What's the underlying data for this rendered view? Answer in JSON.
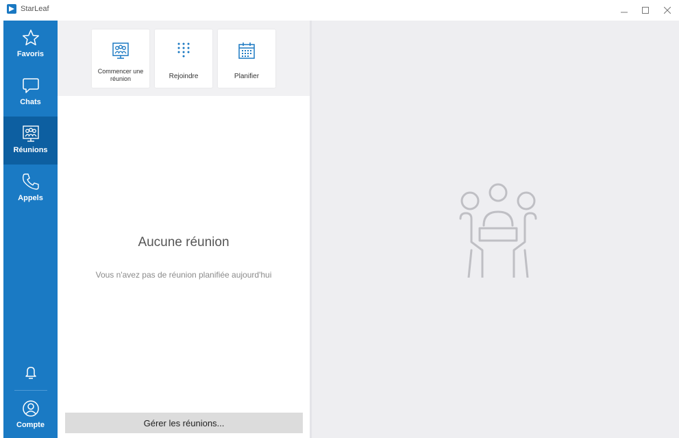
{
  "window": {
    "title": "StarLeaf"
  },
  "sidebar": {
    "items": [
      {
        "label": "Favoris",
        "icon": "star-icon"
      },
      {
        "label": "Chats",
        "icon": "chat-bubble-icon"
      },
      {
        "label": "Réunions",
        "icon": "meeting-icon",
        "active": true
      },
      {
        "label": "Appels",
        "icon": "phone-icon"
      }
    ],
    "bottom": {
      "notifications_icon": "bell-icon",
      "account_label": "Compte",
      "account_icon": "account-icon"
    }
  },
  "actions": [
    {
      "label": "Commencer une réunion",
      "icon": "meeting-icon"
    },
    {
      "label": "Rejoindre",
      "icon": "keypad-icon"
    },
    {
      "label": "Planifier",
      "icon": "calendar-icon"
    }
  ],
  "empty_state": {
    "title": "Aucune réunion",
    "subtitle": "Vous n'avez pas de réunion planifiée aujourd'hui"
  },
  "manage_button": "Gérer les réunions...",
  "colors": {
    "sidebar": "#1a7ac4",
    "sidebar_active": "#0d5fa1",
    "accent": "#1a78c2",
    "pane_bg": "#eeeef1"
  }
}
